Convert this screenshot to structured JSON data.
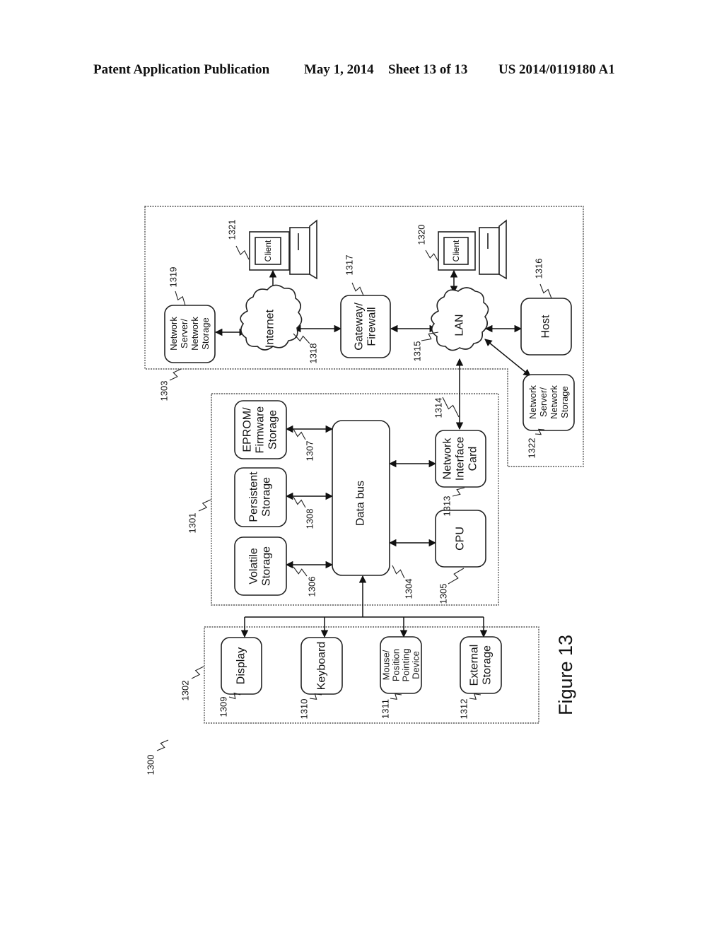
{
  "header": {
    "publication": "Patent Application Publication",
    "date": "May 1, 2014",
    "sheet": "Sheet 13 of 13",
    "number": "US 2014/0119180 A1"
  },
  "figure": {
    "caption": "Figure 13",
    "system_ref": "1300",
    "groups": {
      "network": "1303",
      "computer": "1301",
      "peripherals": "1302"
    },
    "nodes": {
      "network_server_1319": {
        "lines": [
          "Network",
          "Server/",
          "Network",
          "Storage"
        ],
        "ref": "1319"
      },
      "internet": {
        "lines": [
          "Internet"
        ],
        "ref": "1318"
      },
      "client_1321": {
        "lines": [
          "Client"
        ],
        "ref": "1321"
      },
      "gateway": {
        "lines": [
          "Gateway/",
          "Firewall"
        ],
        "ref": "1317"
      },
      "lan": {
        "lines": [
          "LAN"
        ],
        "ref": "1315"
      },
      "client_1320": {
        "lines": [
          "Client"
        ],
        "ref": "1320"
      },
      "host": {
        "lines": [
          "Host"
        ],
        "ref": "1316"
      },
      "network_server_1322": {
        "lines": [
          "Network",
          "Server/",
          "Network",
          "Storage"
        ],
        "ref": "1322"
      },
      "eprom": {
        "lines": [
          "EPROM/",
          "Firmware",
          "Storage"
        ],
        "ref": "1307"
      },
      "persistent": {
        "lines": [
          "Persistent",
          "Storage"
        ],
        "ref": "1308"
      },
      "volatile": {
        "lines": [
          "Volatile",
          "Storage"
        ],
        "ref": "1306"
      },
      "data_bus": {
        "lines": [
          "Data bus"
        ],
        "ref": "1304"
      },
      "nic": {
        "lines": [
          "Network",
          "Interface",
          "Card"
        ],
        "ref": "1313"
      },
      "cpu": {
        "lines": [
          "CPU"
        ],
        "ref": "1305"
      },
      "display": {
        "lines": [
          "Display"
        ],
        "ref": "1309"
      },
      "keyboard": {
        "lines": [
          "Keyboard"
        ],
        "ref": "1310"
      },
      "mouse": {
        "lines": [
          "Mouse/",
          "Position",
          "Pointing",
          "Device"
        ],
        "ref": "1311"
      },
      "external": {
        "lines": [
          "External",
          "Storage"
        ],
        "ref": "1312"
      }
    },
    "links": {
      "nic_lan_ref": "1314"
    }
  }
}
